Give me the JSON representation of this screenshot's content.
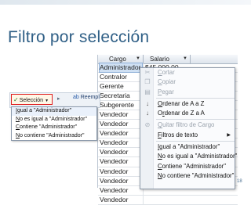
{
  "slide": {
    "title": "Filtro por selección",
    "page_number": "18"
  },
  "grid": {
    "headers": {
      "cargo": "Cargo",
      "salario": "Salario"
    },
    "rows": [
      {
        "cargo": "Administrador",
        "salario": "$45.000,00"
      },
      {
        "cargo": "Contralor",
        "salario": ""
      },
      {
        "cargo": "Gerente",
        "salario": ""
      },
      {
        "cargo": "Secretaria",
        "salario": ""
      },
      {
        "cargo": "Subgerente",
        "salario": ""
      },
      {
        "cargo": "Vendedor",
        "salario": ""
      },
      {
        "cargo": "Vendedor",
        "salario": ""
      },
      {
        "cargo": "Vendedor",
        "salario": ""
      },
      {
        "cargo": "Vendedor",
        "salario": ""
      },
      {
        "cargo": "Vendedor",
        "salario": ""
      },
      {
        "cargo": "Vendedor",
        "salario": ""
      },
      {
        "cargo": "Vendedor",
        "salario": ""
      },
      {
        "cargo": "Vendedor",
        "salario": ""
      },
      {
        "cargo": "Vendedor",
        "salario": ""
      },
      {
        "cargo": "Vendedor",
        "salario": ""
      }
    ]
  },
  "ribbon": {
    "selection_label": "Selección",
    "replace_label": "Reempl",
    "colors": {
      "highlight_border": "#e02020"
    }
  },
  "selection_menu": {
    "items": [
      {
        "pre": "",
        "u": "I",
        "post": "gual a \"Administrador\""
      },
      {
        "pre": "",
        "u": "N",
        "post": "o es igual a \"Administrador\""
      },
      {
        "pre": "",
        "u": "C",
        "post": "ontiene \"Administrador\""
      },
      {
        "pre": "",
        "u": "N",
        "post": "o contiene \"Administrador\""
      }
    ]
  },
  "context_menu": {
    "items": [
      {
        "icon": "cut-icon",
        "glyph": "✂",
        "pre": "",
        "u": "C",
        "post": "ortar",
        "disabled": true
      },
      {
        "icon": "copy-icon",
        "glyph": "❐",
        "pre": "",
        "u": "C",
        "post": "opiar",
        "disabled": true
      },
      {
        "icon": "paste-icon",
        "glyph": "▤",
        "pre": "",
        "u": "P",
        "post": "egar",
        "disabled": true
      },
      {
        "sep": true
      },
      {
        "icon": "sort-asc-icon",
        "glyph": "↓",
        "pre": "",
        "u": "O",
        "post": "rdenar de A a Z",
        "disabled": false
      },
      {
        "icon": "sort-desc-icon",
        "glyph": "↓",
        "pre": "O",
        "u": "r",
        "post": "denar de Z a A",
        "disabled": false
      },
      {
        "sep": true
      },
      {
        "icon": "clear-filter-icon",
        "glyph": "⊘",
        "pre": "",
        "u": "Q",
        "post": "uitar filtro de Cargo",
        "disabled": true
      },
      {
        "icon": "",
        "glyph": "",
        "pre": "",
        "u": "F",
        "post": "iltros de texto",
        "disabled": false,
        "submenu": true
      },
      {
        "sep": true
      },
      {
        "icon": "",
        "glyph": "",
        "pre": "",
        "u": "I",
        "post": "gual a \"Administrador\"",
        "disabled": false
      },
      {
        "icon": "",
        "glyph": "",
        "pre": "",
        "u": "N",
        "post": "o es igual a \"Administrador\"",
        "disabled": false
      },
      {
        "icon": "",
        "glyph": "",
        "pre": "",
        "u": "C",
        "post": "ontiene \"Administrador\"",
        "disabled": false
      },
      {
        "icon": "",
        "glyph": "",
        "pre": "",
        "u": "N",
        "post": "o contiene \"Administrador\"",
        "disabled": false
      }
    ]
  }
}
